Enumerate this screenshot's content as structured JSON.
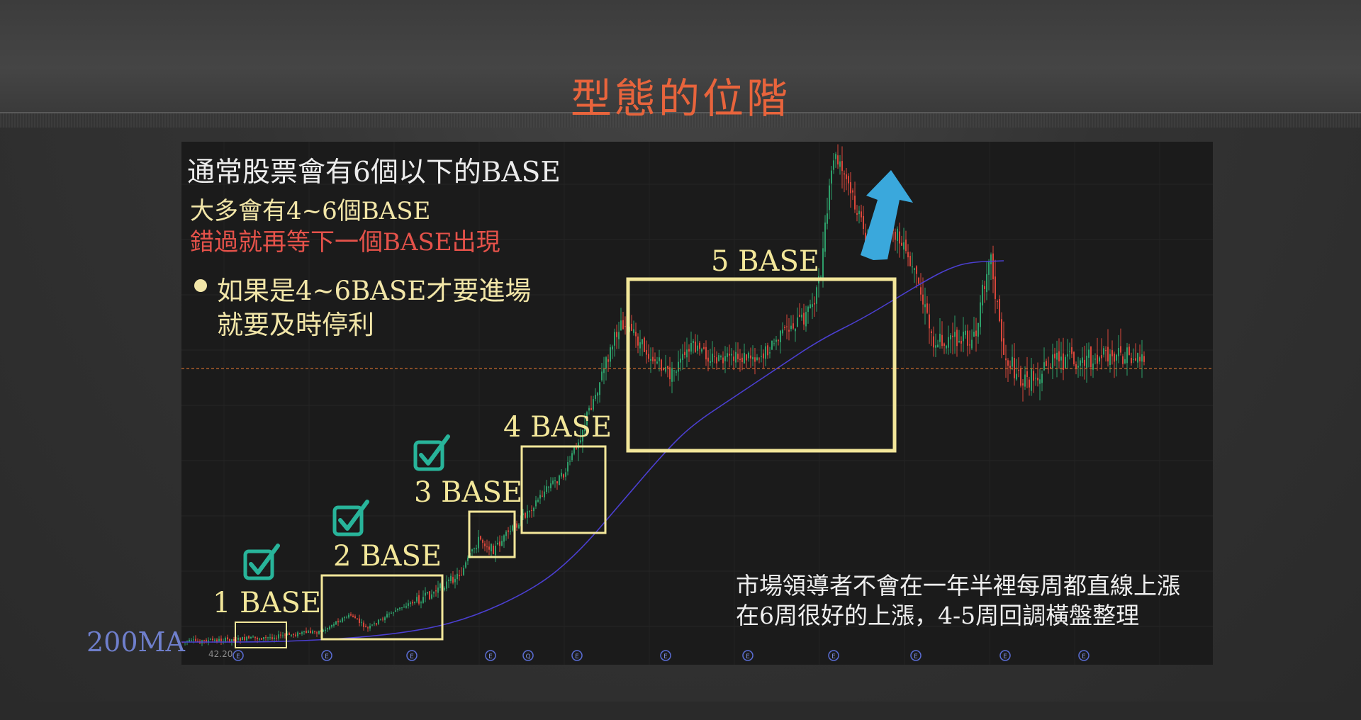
{
  "slide": {
    "title": "型態的位階",
    "notes": {
      "line1": "通常股票會有6個以下的BASE",
      "line2": "大多會有4~6個BASE",
      "line3": "錯過就再等下一個BASE出現",
      "bullet1": "如果是4~6BASE才要進場",
      "bullet2": "就要及時停利",
      "bottom1": "市場領導者不會在一年半裡每周都直線上漲",
      "bottom2": "在6周很好的上漲，4-5周回調橫盤整理"
    },
    "ma_label": "200MA",
    "price_tick": "42.20"
  },
  "chart_data": {
    "type": "candlestick",
    "title": "",
    "xlabel": "",
    "ylabel": "",
    "moving_average": "200MA",
    "colors": {
      "up": "#2e9f6a",
      "down": "#d9473b",
      "ma": "#4b3fd1",
      "base_box": "#f3e79a",
      "check": "#28b49a",
      "arrow": "#3aa8dc",
      "reference_line": "#c76a2f"
    },
    "bases": [
      {
        "label": "1 BASE",
        "checked": true
      },
      {
        "label": "2 BASE",
        "checked": true
      },
      {
        "label": "3 BASE",
        "checked": true
      },
      {
        "label": "4 BASE",
        "checked": false
      },
      {
        "label": "5 BASE",
        "checked": false
      }
    ],
    "event_markers": [
      "E",
      "E",
      "E",
      "E",
      "Q",
      "E",
      "E",
      "E",
      "E",
      "E",
      "E",
      "E"
    ]
  }
}
